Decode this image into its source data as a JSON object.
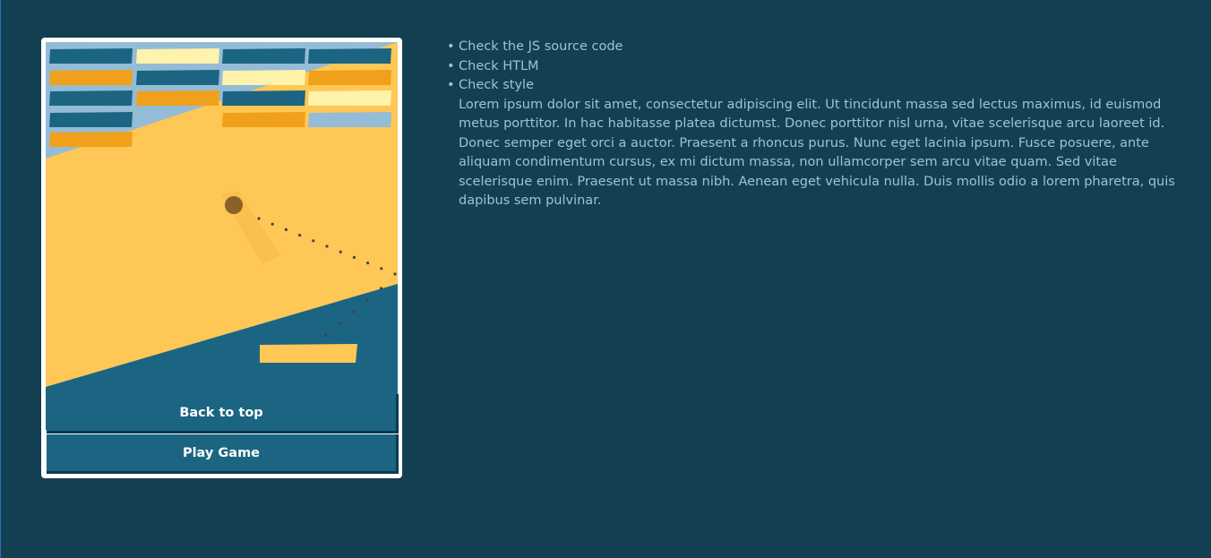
{
  "game": {
    "bricks": {
      "rows": [
        [
          "dark",
          "light",
          "dark",
          "dark"
        ],
        [
          "orange",
          "dark",
          "light",
          "orange"
        ],
        [
          "dark",
          "orange",
          "dark",
          "light"
        ],
        [
          "dark",
          "none",
          "orange",
          "pale"
        ],
        [
          "orange",
          "none",
          "none",
          "none"
        ]
      ]
    },
    "colors": {
      "background_top": "#94bcd6",
      "background_mid": "#ffc755",
      "background_bottom": "#1b6582",
      "brick_dark": "#1b6582",
      "brick_light": "#fff2ab",
      "brick_orange": "#f0a01a",
      "brick_pale": "#94bcd6",
      "ball": "#8c6029",
      "paddle": "#ffc755"
    },
    "buttons": {
      "back_to_top": "Back to top",
      "play_game": "Play Game"
    }
  },
  "info": {
    "bullets": [
      "Check the JS source code",
      "Check HTLM",
      "Check style"
    ],
    "paragraph": "Lorem ipsum dolor sit amet, consectetur adipiscing elit. Ut tincidunt massa sed lectus maximus, id euismod metus porttitor. In hac habitasse platea dictumst. Donec porttitor nisl urna, vitae scelerisque arcu laoreet id. Donec semper eget orci a auctor. Praesent a rhoncus purus. Nunc eget lacinia ipsum. Fusce posuere, ante aliquam condimentum cursus, ex mi dictum massa, non ullamcorper sem arcu vitae quam. Sed vitae scelerisque enim. Praesent ut massa nibh. Aenean eget vehicula nulla. Duis mollis odio a lorem pharetra, quis dapibus sem pulvinar."
  }
}
